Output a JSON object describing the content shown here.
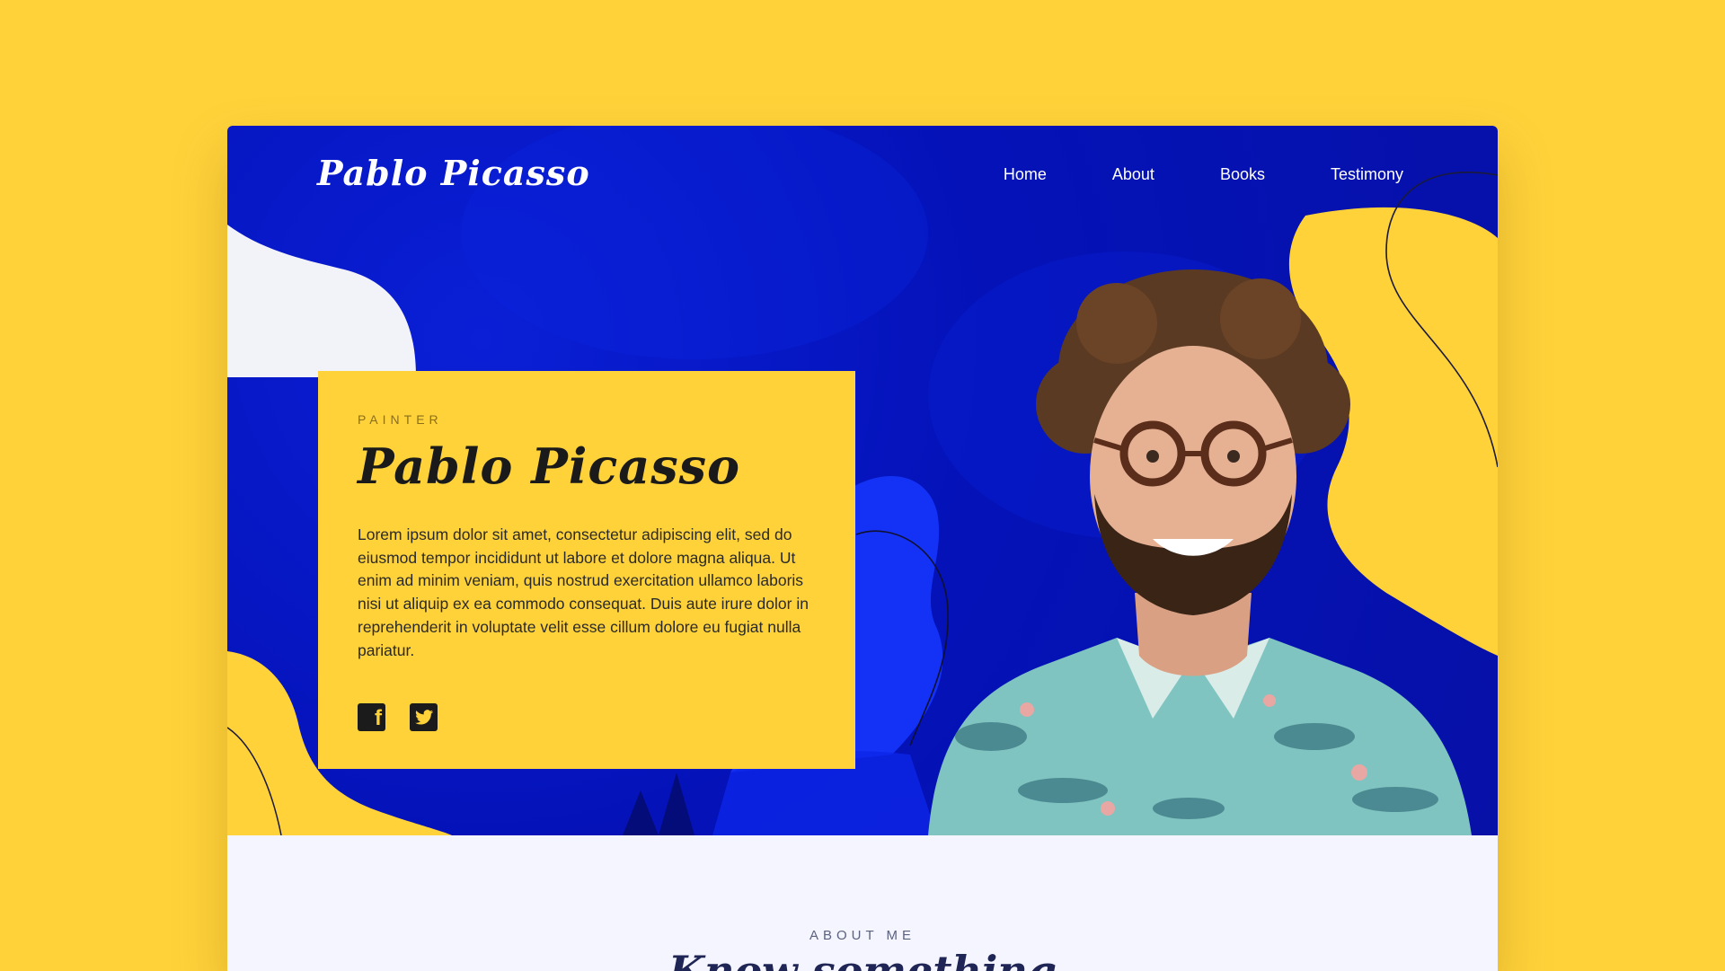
{
  "site": {
    "logo": "Pablo Picasso"
  },
  "nav": {
    "items": [
      "Home",
      "About",
      "Books",
      "Testimony"
    ]
  },
  "hero": {
    "kicker": "PAINTER",
    "name": "Pablo Picasso",
    "bio": "Lorem ipsum dolor sit amet, consectetur adipiscing elit, sed do eiusmod tempor incididunt ut labore et dolore magna aliqua. Ut enim ad minim veniam, quis nostrud exercitation ullamco laboris nisi ut aliquip ex ea commodo consequat. Duis aute irure dolor in reprehenderit in voluptate velit esse cillum dolore eu fugiat nulla pariatur.",
    "social": {
      "facebook_glyph": "f",
      "twitter_icon": "twitter-icon",
      "facebook_icon": "facebook-icon"
    }
  },
  "about": {
    "kicker": "ABOUT ME",
    "heading": "Know something"
  },
  "colors": {
    "accent_yellow": "#FFD23A",
    "hero_blue": "#0412B8",
    "about_bg": "#F4F5FF",
    "heading_navy": "#1F2554"
  }
}
